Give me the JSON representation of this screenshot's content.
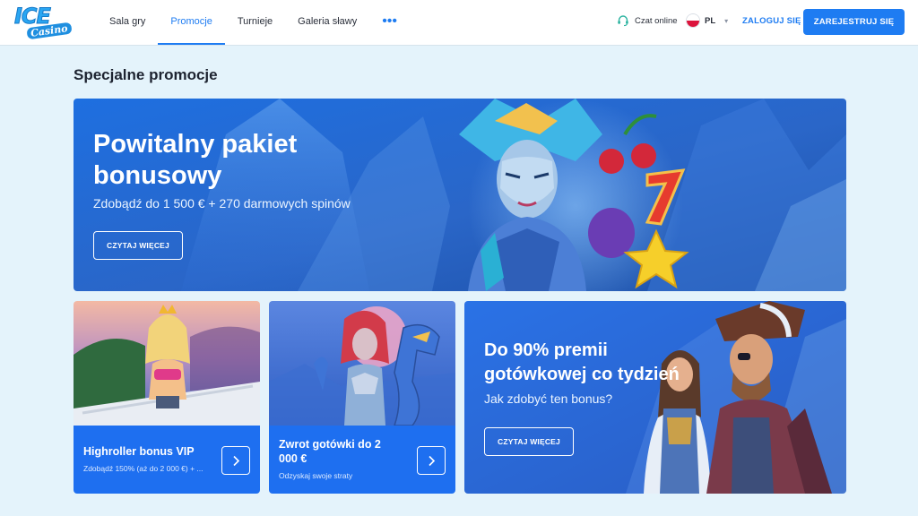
{
  "brand": {
    "logo_main": "ICE",
    "logo_sub": "Casino"
  },
  "nav": {
    "items": [
      {
        "label": "Sala gry"
      },
      {
        "label": "Promocje",
        "active": true
      },
      {
        "label": "Turnieje"
      },
      {
        "label": "Galeria sławy"
      }
    ],
    "more_icon": "more-dots-icon",
    "more_symbol": "•••"
  },
  "header": {
    "chat_label": "Czat online",
    "chat_icon": "chat-headset-icon",
    "language": "PL",
    "language_flag": "poland-flag-icon",
    "login_label": "ZALOGUJ SIĘ",
    "register_label": "ZAREJESTRUJ SIĘ"
  },
  "colors": {
    "accent": "#1e7cf2",
    "background": "#e4f3fb",
    "card_footer": "#1e6ff0"
  },
  "page": {
    "section_title": "Specjalne promocje"
  },
  "promos": {
    "hero": {
      "title": "Powitalny pakiet bonusowy",
      "subtitle": "Zdobądź do 1 500 € + 270 darmowych spinów",
      "button": "CZYTAJ WIĘCEJ"
    },
    "vip": {
      "title": "Highroller bonus VIP",
      "subtitle": "Zdobądź 150% (aż do 2 000 €) + ...",
      "arrow_icon": "chevron-right-icon"
    },
    "cashback": {
      "title": "Zwrot gotówki do 2 000 €",
      "subtitle": "Odzyskaj swoje straty",
      "arrow_icon": "chevron-right-icon"
    },
    "weekly": {
      "title": "Do 90% premii gotówkowej co tydzień",
      "subtitle": "Jak zdobyć ten bonus?",
      "button": "CZYTAJ WIĘCEJ"
    }
  }
}
